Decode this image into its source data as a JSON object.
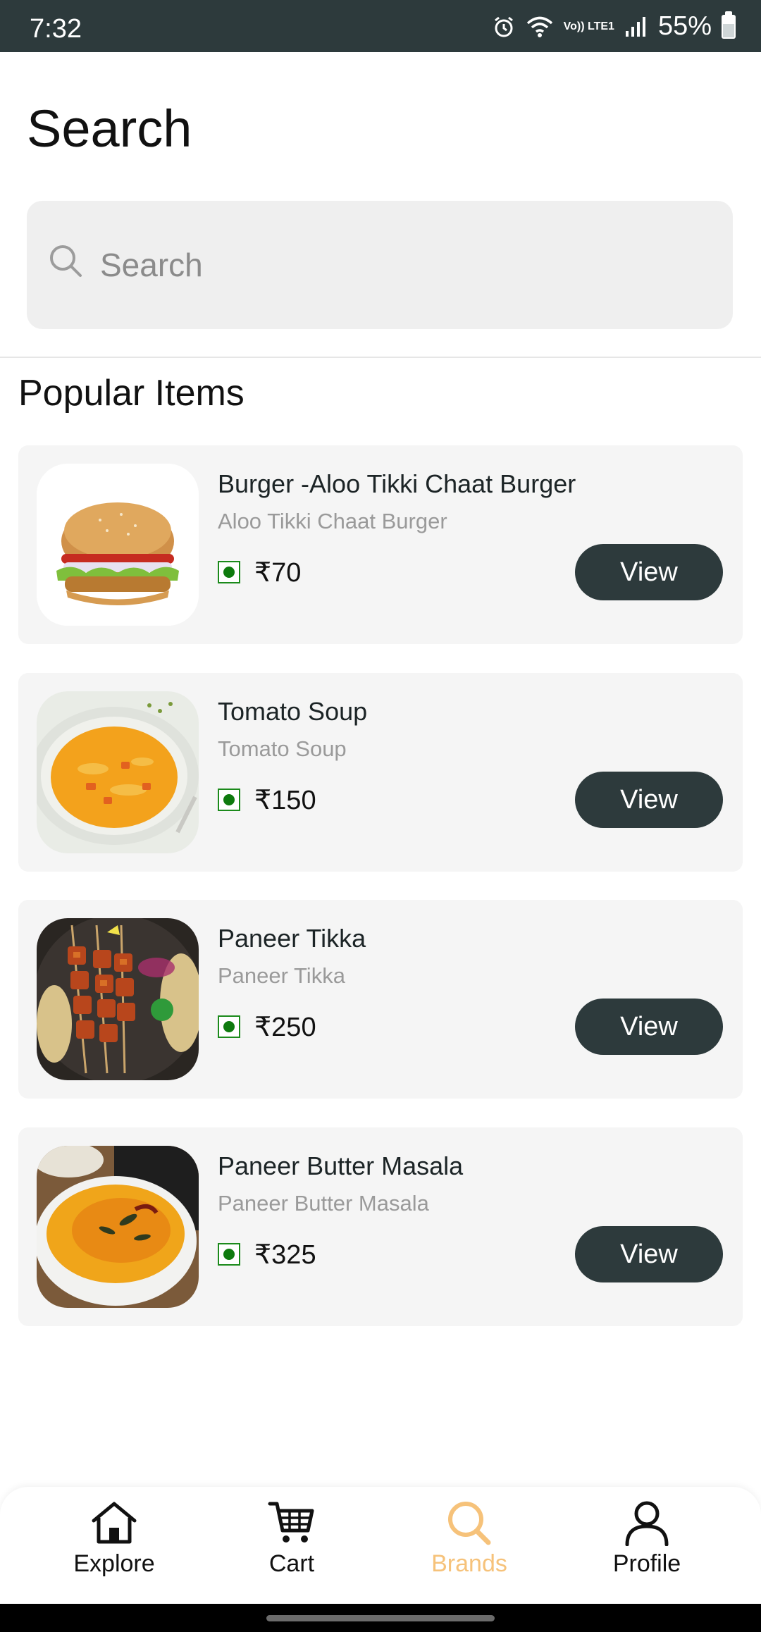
{
  "status_bar": {
    "time": "7:32",
    "battery_percent": "55%",
    "network_label": "Vo)) LTE1",
    "battery_level": 0.55
  },
  "header": {
    "title": "Search"
  },
  "search": {
    "placeholder": "Search",
    "value": ""
  },
  "section": {
    "title": "Popular Items"
  },
  "items": [
    {
      "name": "Burger -Aloo Tikki Chaat Burger",
      "subtitle": "Aloo Tikki Chaat Burger",
      "price": "₹70",
      "button_label": "View",
      "image": "burger"
    },
    {
      "name": "Tomato Soup",
      "subtitle": "Tomato Soup",
      "price": "₹150",
      "button_label": "View",
      "image": "tomato-soup"
    },
    {
      "name": "Paneer Tikka",
      "subtitle": "Paneer Tikka",
      "price": "₹250",
      "button_label": "View",
      "image": "paneer-tikka"
    },
    {
      "name": "Paneer Butter Masala",
      "subtitle": "Paneer Butter Masala",
      "price": "₹325",
      "button_label": "View",
      "image": "paneer-butter-masala"
    }
  ],
  "bottom_nav": [
    {
      "label": "Explore",
      "icon": "home-icon",
      "active": false
    },
    {
      "label": "Cart",
      "icon": "cart-icon",
      "active": false
    },
    {
      "label": "Brands",
      "icon": "search-icon",
      "active": true
    },
    {
      "label": "Profile",
      "icon": "person-icon",
      "active": false
    }
  ],
  "colors": {
    "accent_dark": "#2d3a3c",
    "active_nav": "#f6c27a",
    "veg_green": "#0e7a0e",
    "card_bg": "#f5f5f5"
  }
}
